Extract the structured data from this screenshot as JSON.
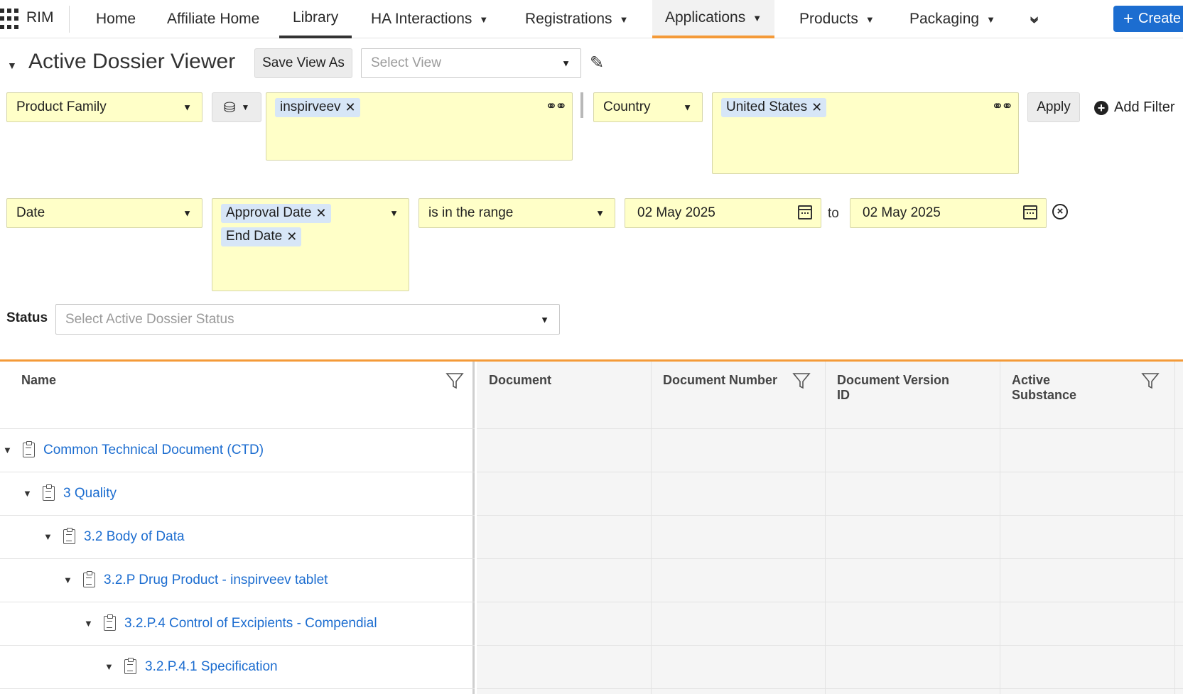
{
  "nav": {
    "app_name": "RIM",
    "tabs": [
      "Home",
      "Affiliate Home",
      "Library",
      "HA Interactions",
      "Registrations",
      "Applications",
      "Products",
      "Packaging"
    ],
    "create_label": "Create"
  },
  "viewer": {
    "title": "Active Dossier Viewer",
    "save_view_label": "Save View As",
    "select_view_placeholder": "Select View"
  },
  "filters": {
    "row1": {
      "field1": "Product Family",
      "tags1": [
        "inspirveev"
      ],
      "field2": "Country",
      "tags2": [
        "United States"
      ],
      "apply_label": "Apply",
      "add_filter_label": "Add Filter"
    },
    "row2": {
      "field": "Date",
      "date_tags": [
        "Approval Date",
        "End Date"
      ],
      "operator": "is in the range",
      "from": "02 May 2025",
      "to_label": "to",
      "to": "02 May 2025"
    },
    "status": {
      "label": "Status",
      "placeholder": "Select Active Dossier Status"
    }
  },
  "table": {
    "columns": [
      "Name",
      "Document",
      "Document Number",
      "Document Version ID",
      "Active Substance"
    ],
    "rows": [
      {
        "label": "Common Technical Document (CTD)",
        "level": 0
      },
      {
        "label": "3 Quality",
        "level": 1
      },
      {
        "label": "3.2 Body of Data",
        "level": 2
      },
      {
        "label": "3.2.P Drug Product - inspirveev tablet",
        "level": 3
      },
      {
        "label": "3.2.P.4 Control of Excipients - Compendial",
        "level": 4
      },
      {
        "label": "3.2.P.4.1 Specification",
        "level": 5
      }
    ]
  },
  "colors": {
    "accent": "#f49a38",
    "link": "#1c6dd0",
    "filter_bg": "#ffffc8",
    "tag_bg": "#d7e6f7",
    "primary": "#1c6dd0"
  }
}
